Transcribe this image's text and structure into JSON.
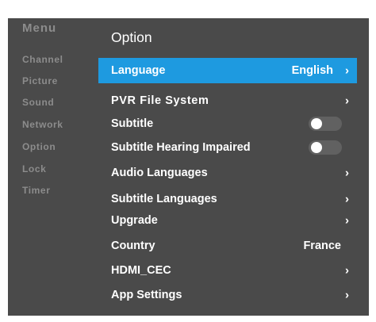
{
  "menu": {
    "title": "Menu",
    "items": [
      {
        "label": "Channel"
      },
      {
        "label": "Picture"
      },
      {
        "label": "Sound"
      },
      {
        "label": "Network"
      },
      {
        "label": "Option"
      },
      {
        "label": "Lock"
      },
      {
        "label": "Timer"
      }
    ]
  },
  "panel": {
    "title": "Option",
    "rows": [
      {
        "label": "Language",
        "value": "English",
        "chevron": "›",
        "selected": true
      },
      {
        "label": "PVR File System",
        "chevron": "›"
      },
      {
        "label": "Subtitle",
        "toggle": "off"
      },
      {
        "label": "Subtitle Hearing Impaired",
        "toggle": "off"
      },
      {
        "label": "Audio Languages",
        "chevron": "›"
      },
      {
        "label": "Subtitle Languages",
        "chevron": "›"
      },
      {
        "label": "Upgrade",
        "chevron": "›"
      },
      {
        "label": "Country",
        "value": "France"
      },
      {
        "label": "HDMI_CEC",
        "chevron": "›"
      },
      {
        "label": "App Settings",
        "chevron": "›"
      }
    ]
  },
  "colors": {
    "background": "#4a4a4a",
    "selected": "#1e9ae0",
    "sidebar_text": "#8c8c8c",
    "toggle_track": "#616161"
  },
  "icons": {
    "chevron": "chevron-right-icon",
    "toggle": "toggle-switch-icon"
  }
}
